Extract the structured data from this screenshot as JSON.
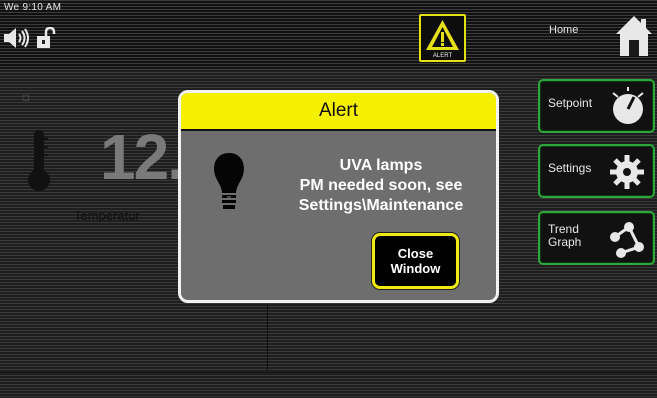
{
  "status_bar": {
    "time": "We 9:10 AM",
    "speaker_icon": "speaker-volume-icon",
    "lock_icon": "padlock-open-icon",
    "alert_indicator_label": "ALERT",
    "alert_icon": "warning-triangle-icon",
    "home_label": "Home",
    "home_icon": "house-icon"
  },
  "main": {
    "big_value": "12.",
    "temperature_label": "Temperatur",
    "thermometer_icon": "thermometer-icon"
  },
  "side_buttons": [
    {
      "label": "Setpoint",
      "icon": "dial-icon"
    },
    {
      "label": "Settings",
      "icon": "gear-icon"
    },
    {
      "label": "Trend\nGraph",
      "icon": "trend-graph-icon"
    }
  ],
  "dialog": {
    "title": "Alert",
    "message_line1": "UVA lamps",
    "message_line2": "PM needed soon, see",
    "message_line3": "Settings\\Maintenance",
    "close_line1": "Close",
    "close_line2": "Window",
    "bulb_icon": "light-bulb-icon"
  },
  "colors": {
    "alert_header": "#f5ef00",
    "dialog_bg": "#6e6e6e",
    "side_button_border": "#2ea63a",
    "close_border": "#f1ea12"
  }
}
